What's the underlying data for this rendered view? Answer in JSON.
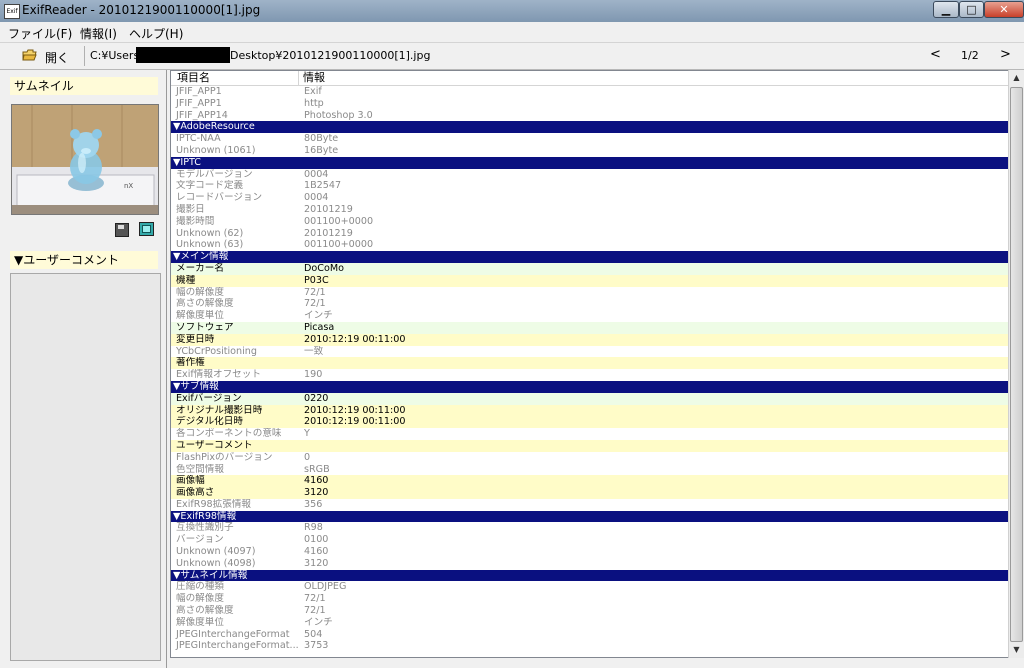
{
  "window": {
    "title": "ExifReader - 2010121900110000[1].jpg",
    "app_icon_text": "Exif"
  },
  "menu": [
    "ファイル(F)",
    "情報(I)",
    "ヘルプ(H)"
  ],
  "toolbar": {
    "open_label": "開く",
    "path_prefix": "C:¥Users¥",
    "path_suffix": "Desktop¥2010121900110000[1].jpg",
    "prev": "<",
    "page": "1/2",
    "next": ">"
  },
  "left_panel": {
    "thumbnail_header": "サムネイル",
    "comment_header": "▼ユーザーコメント"
  },
  "list": {
    "headers": {
      "name": "項目名",
      "value": "情報"
    },
    "rows": [
      {
        "name": "JFIF_APP1",
        "value": "Exif",
        "style": "dim"
      },
      {
        "name": "JFIF_APP1",
        "value": "http",
        "style": "dim"
      },
      {
        "name": "JFIF_APP14",
        "value": "Photoshop 3.0",
        "style": "dim"
      },
      {
        "name": "▼AdobeResource",
        "value": "",
        "style": "section"
      },
      {
        "name": "IPTC-NAA",
        "value": "80Byte",
        "style": "dim"
      },
      {
        "name": "Unknown (1061)",
        "value": "16Byte",
        "style": "dim"
      },
      {
        "name": "▼IPTC",
        "value": "",
        "style": "section"
      },
      {
        "name": "モデルバージョン",
        "value": "0004",
        "style": "dim"
      },
      {
        "name": "文字コード定義",
        "value": "1B2547",
        "style": "dim"
      },
      {
        "name": "レコードバージョン",
        "value": "0004",
        "style": "dim"
      },
      {
        "name": "撮影日",
        "value": "20101219",
        "style": "dim"
      },
      {
        "name": "撮影時間",
        "value": "001100+0000",
        "style": "dim"
      },
      {
        "name": "Unknown (62)",
        "value": "20101219",
        "style": "dim"
      },
      {
        "name": "Unknown (63)",
        "value": "001100+0000",
        "style": "dim"
      },
      {
        "name": "▼メイン情報",
        "value": "",
        "style": "section"
      },
      {
        "name": "メーカー名",
        "value": "DoCoMo",
        "style": "hl-g"
      },
      {
        "name": "機種",
        "value": "P03C",
        "style": "hl-y"
      },
      {
        "name": "幅の解像度",
        "value": "72/1",
        "style": "dim"
      },
      {
        "name": "高さの解像度",
        "value": "72/1",
        "style": "dim"
      },
      {
        "name": "解像度単位",
        "value": "インチ",
        "style": "dim"
      },
      {
        "name": "ソフトウェア",
        "value": "Picasa",
        "style": "hl-g"
      },
      {
        "name": "変更日時",
        "value": "2010:12:19 00:11:00",
        "style": "hl-y"
      },
      {
        "name": "YCbCrPositioning",
        "value": "一致",
        "style": "dim"
      },
      {
        "name": "著作権",
        "value": "",
        "style": "hl-y"
      },
      {
        "name": "Exif情報オフセット",
        "value": "190",
        "style": "dim"
      },
      {
        "name": "▼サブ情報",
        "value": "",
        "style": "section"
      },
      {
        "name": "Exifバージョン",
        "value": "0220",
        "style": "hl-g"
      },
      {
        "name": "オリジナル撮影日時",
        "value": "2010:12:19 00:11:00",
        "style": "hl-y"
      },
      {
        "name": "デジタル化日時",
        "value": "2010:12:19 00:11:00",
        "style": "hl-y"
      },
      {
        "name": "各コンポーネントの意味",
        "value": "Y",
        "style": "dim"
      },
      {
        "name": "ユーザーコメント",
        "value": "",
        "style": "hl-y"
      },
      {
        "name": "FlashPixのバージョン",
        "value": "0",
        "style": "dim"
      },
      {
        "name": "色空間情報",
        "value": "sRGB",
        "style": "dim"
      },
      {
        "name": "画像幅",
        "value": "4160",
        "style": "hl-y"
      },
      {
        "name": "画像高さ",
        "value": "3120",
        "style": "hl-y"
      },
      {
        "name": "ExifR98拡張情報",
        "value": "356",
        "style": "dim"
      },
      {
        "name": "▼ExifR98情報",
        "value": "",
        "style": "section"
      },
      {
        "name": "互換性識別子",
        "value": "R98",
        "style": "dim"
      },
      {
        "name": "バージョン",
        "value": "0100",
        "style": "dim"
      },
      {
        "name": "Unknown (4097)",
        "value": "4160",
        "style": "dim"
      },
      {
        "name": "Unknown (4098)",
        "value": "3120",
        "style": "dim"
      },
      {
        "name": "▼サムネイル情報",
        "value": "",
        "style": "section"
      },
      {
        "name": "圧縮の種類",
        "value": "OLDJPEG",
        "style": "dim"
      },
      {
        "name": "幅の解像度",
        "value": "72/1",
        "style": "dim"
      },
      {
        "name": "高さの解像度",
        "value": "72/1",
        "style": "dim"
      },
      {
        "name": "解像度単位",
        "value": "インチ",
        "style": "dim"
      },
      {
        "name": "JPEGInterchangeFormat",
        "value": "504",
        "style": "dim"
      },
      {
        "name": "JPEGInterchangeFormat...",
        "value": "3753",
        "style": "dim"
      }
    ]
  },
  "icons": {
    "app": "exif-app-icon",
    "open": "open-folder-icon",
    "save": "save-icon",
    "view": "view-image-icon"
  },
  "colors": {
    "section_bg": "#0a1080",
    "highlight_yellow": "#fffcc8",
    "highlight_green": "#eefce6",
    "dim_text": "#8a8a8a"
  }
}
